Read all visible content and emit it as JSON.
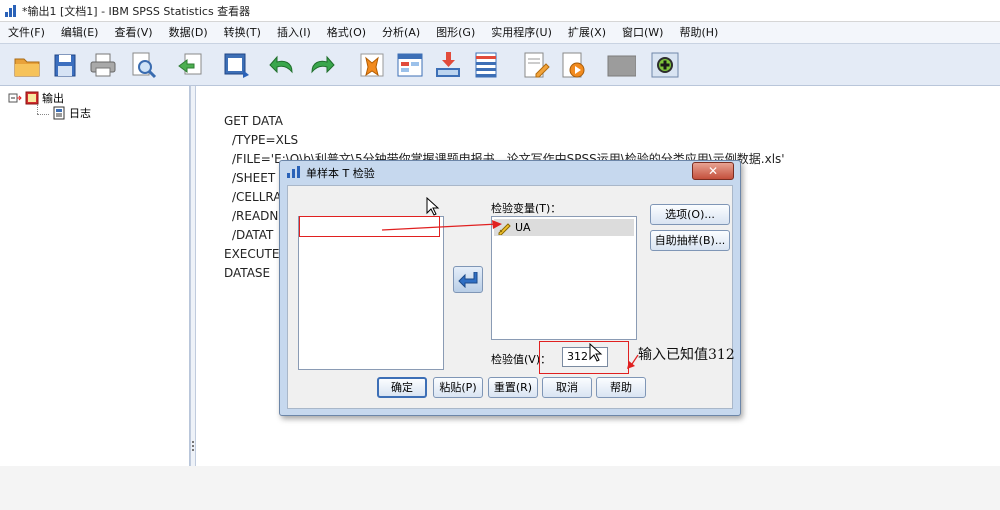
{
  "window": {
    "title": "*输出1 [文档1] - IBM SPSS Statistics 查看器"
  },
  "menu": {
    "items": [
      {
        "label": "文件(F)"
      },
      {
        "label": "编辑(E)"
      },
      {
        "label": "查看(V)"
      },
      {
        "label": "数据(D)"
      },
      {
        "label": "转换(T)"
      },
      {
        "label": "插入(I)"
      },
      {
        "label": "格式(O)"
      },
      {
        "label": "分析(A)"
      },
      {
        "label": "图形(G)"
      },
      {
        "label": "实用程序(U)"
      },
      {
        "label": "扩展(X)"
      },
      {
        "label": "窗口(W)"
      },
      {
        "label": "帮助(H)"
      }
    ]
  },
  "toolbar": {
    "icons": [
      "open-folder-icon",
      "save-icon",
      "print-icon",
      "print-preview-icon",
      "export-icon",
      "recall-dialog-icon",
      "undo-icon",
      "redo-icon",
      "goto-data-icon",
      "goto-case-icon",
      "insert-variable-icon",
      "variables-icon",
      "new-output-icon",
      "script-icon",
      "run-icon",
      "disabled-icon",
      "add-icon"
    ]
  },
  "outline": {
    "root": "输出",
    "child": "日志"
  },
  "syntax": {
    "lines": [
      "GET DATA",
      "/TYPE=XLS",
      "/FILE='E:\\O\\b\\利普文\\5分钟带你掌握课题申报书、论文写作中SPSS运用\\检验的分类应用\\示例数据.xls'",
      "/SHEET",
      "/CELLRA",
      "/READN",
      "/DATAT",
      "EXECUTE",
      "DATASE"
    ]
  },
  "dialog": {
    "title": "单样本 T 检验",
    "close_label": "✕",
    "test_variables_label": "检验变量(T)：",
    "test_variable_item": "UA",
    "test_value_label": "检验值(V)：",
    "test_value": "312",
    "buttons": {
      "options": "选项(O)...",
      "bootstrap": "自助抽样(B)...",
      "ok": "确定",
      "paste": "粘贴(P)",
      "reset": "重置(R)",
      "cancel": "取消",
      "help": "帮助"
    }
  },
  "annotation": {
    "text": "输入已知值312",
    "color": "#e02020"
  }
}
